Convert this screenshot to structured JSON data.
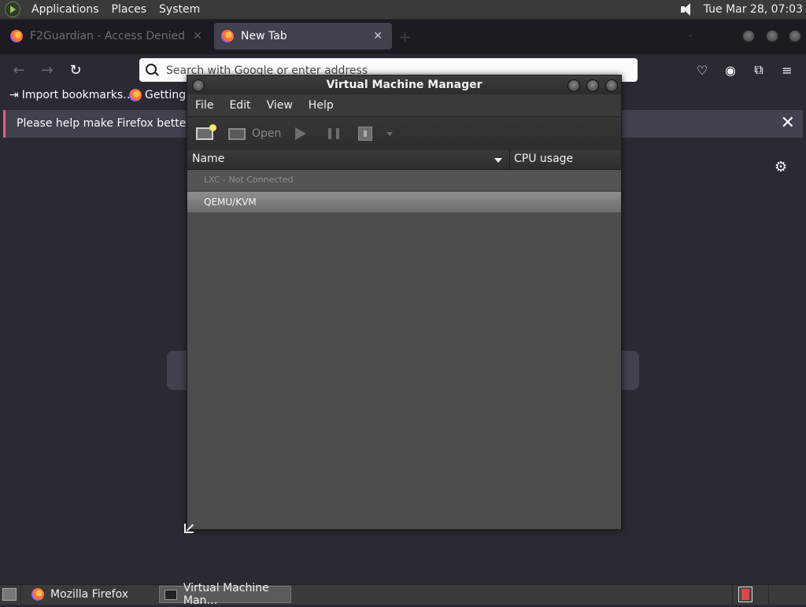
{
  "top_panel": {
    "menus": [
      "Applications",
      "Places",
      "System"
    ],
    "clock": "Tue Mar 28, 07:03"
  },
  "firefox": {
    "tabs": [
      {
        "title": "F2Guardian - Access Denied",
        "active": false
      },
      {
        "title": "New Tab",
        "active": true
      }
    ],
    "urlbar_placeholder": "Search with Google or enter address",
    "bookmarks": [
      "Import bookmarks…",
      "Getting S"
    ],
    "notification": "Please help make Firefox better by ta"
  },
  "vmm": {
    "title": "Virtual Machine Manager",
    "menus": [
      "File",
      "Edit",
      "View",
      "Help"
    ],
    "toolbar": {
      "open_label": "Open"
    },
    "columns": {
      "name": "Name",
      "cpu": "CPU usage"
    },
    "rows": [
      {
        "name": "LXC - Not Connected",
        "connected": false
      },
      {
        "name": "QEMU/KVM",
        "connected": true,
        "selected": true
      }
    ]
  },
  "taskbar": {
    "tasks": [
      {
        "label": "Mozilla Firefox",
        "active": false
      },
      {
        "label": "Virtual Machine Man…",
        "active": true
      }
    ]
  },
  "colors": {
    "firefox_bg": "#2b2a33",
    "notify_accent": "#e55d8b",
    "panel_bg": "#3a3a3a"
  }
}
